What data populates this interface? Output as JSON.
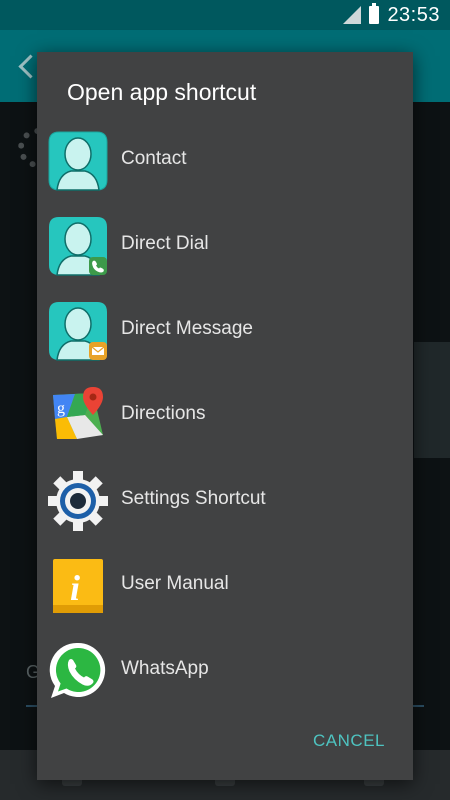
{
  "status_bar": {
    "time": "23:53"
  },
  "background": {
    "partial_text": "G"
  },
  "dialog": {
    "title": "Open app shortcut",
    "items": [
      {
        "label": "Contact",
        "icon": "contact-icon"
      },
      {
        "label": "Direct Dial",
        "icon": "direct-dial-icon"
      },
      {
        "label": "Direct Message",
        "icon": "direct-message-icon"
      },
      {
        "label": "Directions",
        "icon": "maps-icon"
      },
      {
        "label": "Settings Shortcut",
        "icon": "settings-gear-icon"
      },
      {
        "label": "User Manual",
        "icon": "info-icon"
      },
      {
        "label": "WhatsApp",
        "icon": "whatsapp-icon"
      }
    ],
    "cancel_label": "CANCEL"
  },
  "colors": {
    "accent": "#4ec3c0",
    "status_bar": "#00585e",
    "dialog_bg": "#414243",
    "teal_avatar": "#26c6be"
  }
}
